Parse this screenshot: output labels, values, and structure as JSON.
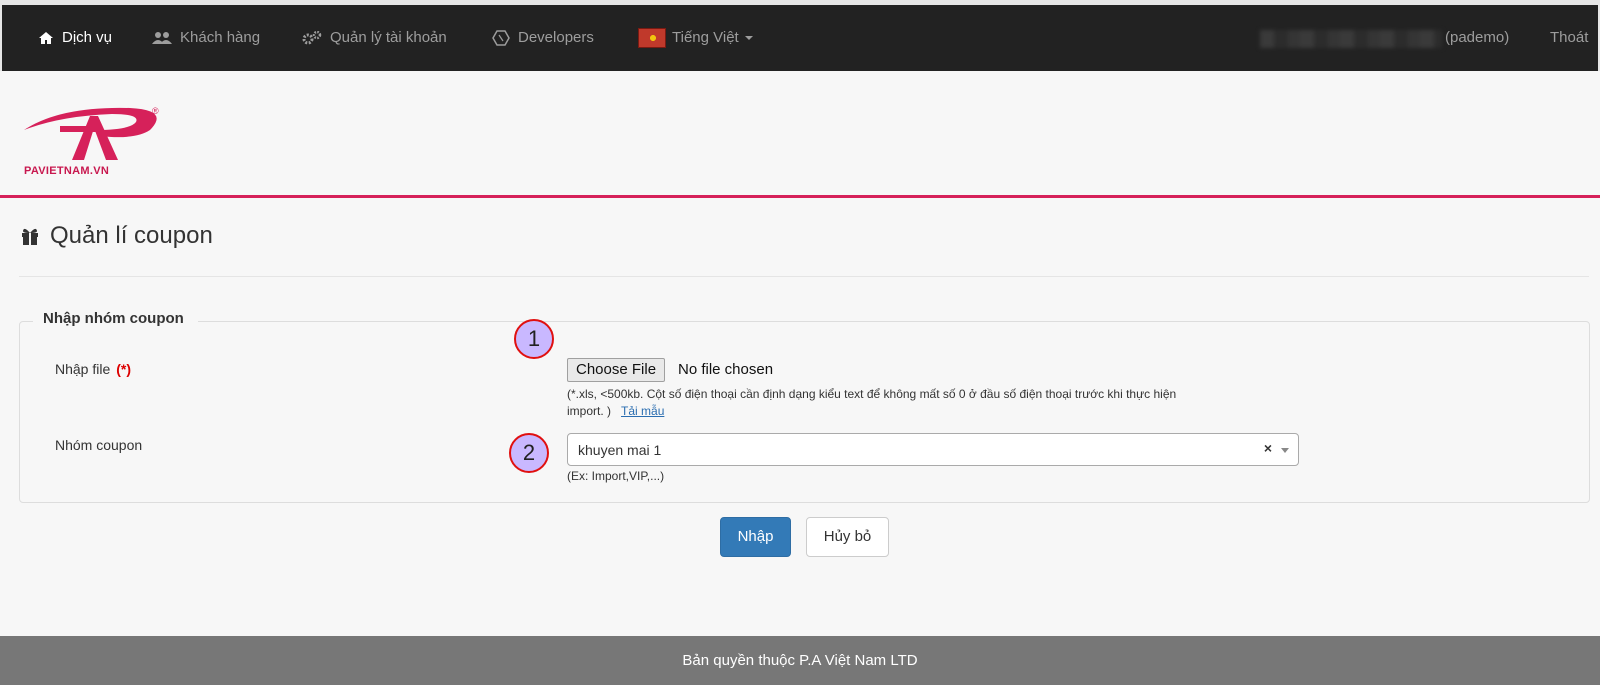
{
  "nav": {
    "services": "Dịch vụ",
    "customers": "Khách hàng",
    "account": "Quản lý tài khoản",
    "developers": "Developers",
    "language": "Tiếng Việt",
    "user": "(pademo)",
    "logout": "Thoát"
  },
  "logo": {
    "text": "PAVIETNAM.VN",
    "registered": "®"
  },
  "page": {
    "title": "Quản lí coupon"
  },
  "form": {
    "legend": "Nhập nhóm coupon",
    "file_label": "Nhập file",
    "required_mark": "(*)",
    "file_button": "Choose File",
    "file_status": "No file chosen",
    "file_help_line1": "(*.xls, <500kb. Cột số điện thoại cần định dạng kiểu text để không mất số 0 ở đầu số điện thoại trước khi thực hiện",
    "file_help_line2": "import. )",
    "template_link": "Tải mẫu",
    "group_label": "Nhóm coupon",
    "group_value": "khuyen mai 1",
    "group_clear": "×",
    "group_help": "(Ex: Import,VIP,...)"
  },
  "annotations": {
    "one": "1",
    "two": "2"
  },
  "buttons": {
    "submit": "Nhập",
    "cancel": "Hủy bỏ"
  },
  "footer": {
    "text": "Bản quyền thuộc P.A Việt Nam LTD"
  },
  "colors": {
    "brand": "#d6215a",
    "primary": "#337ab7",
    "navbar": "#222222",
    "footer": "#777777"
  },
  "icons": [
    "home-icon",
    "users-icon",
    "gears-icon",
    "developers-icon",
    "flag-icon",
    "gift-icon"
  ]
}
